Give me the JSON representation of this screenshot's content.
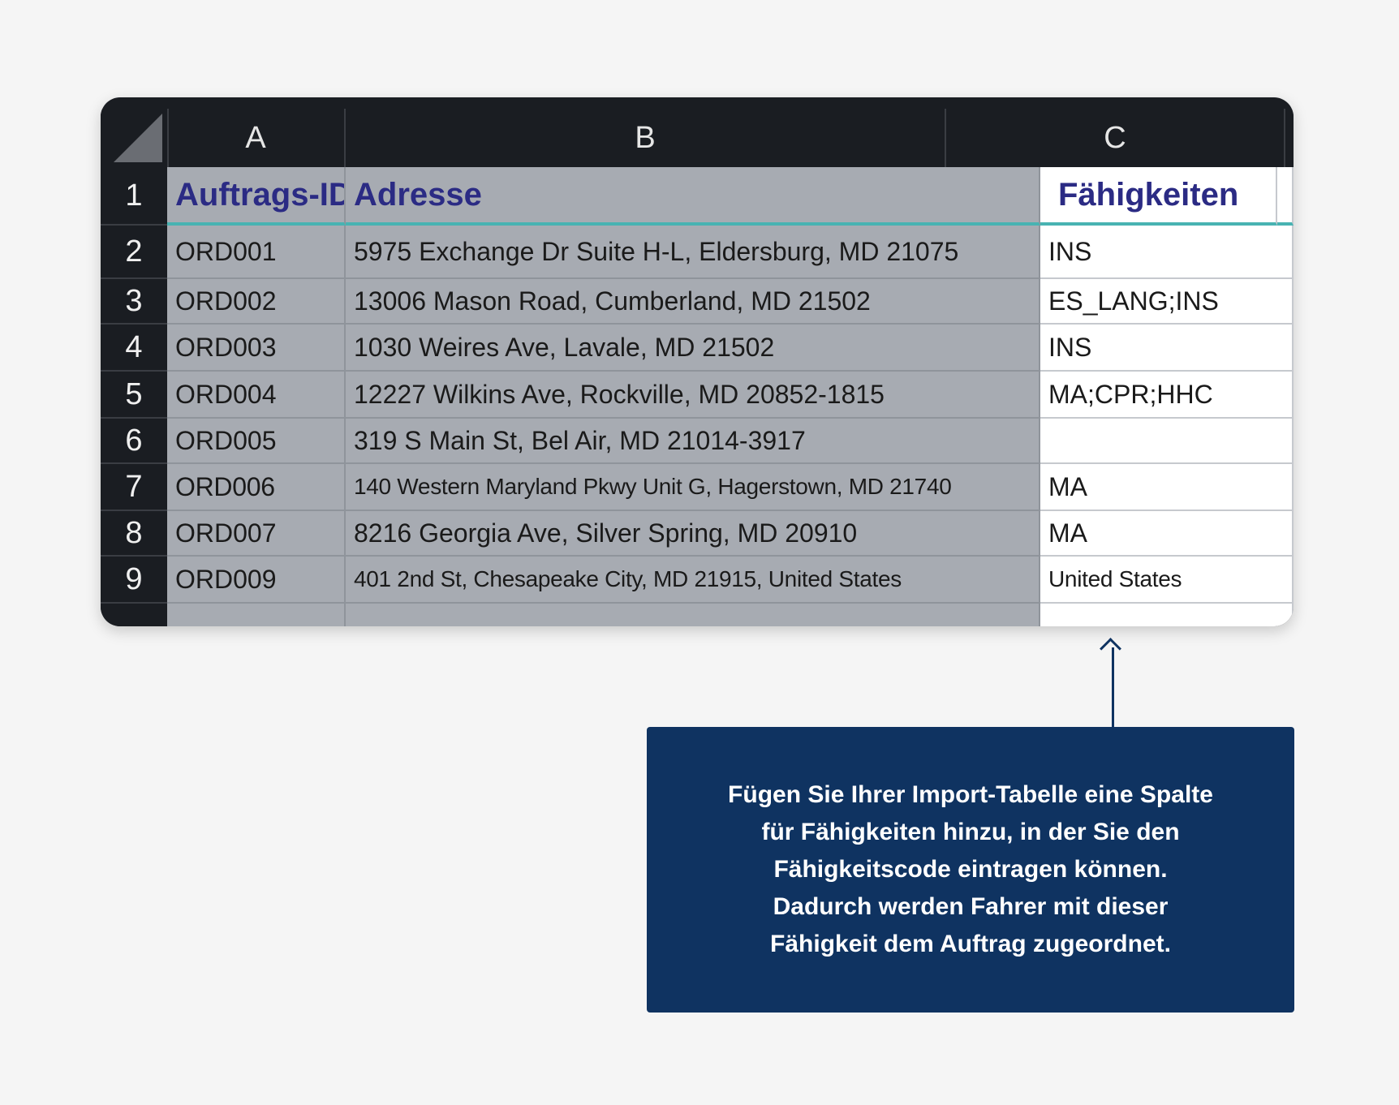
{
  "columns": [
    "A",
    "B",
    "C"
  ],
  "row_numbers": [
    "1",
    "2",
    "3",
    "4",
    "5",
    "6",
    "7",
    "8",
    "9"
  ],
  "header_row": {
    "a": "Auftrags-ID",
    "b": "Adresse",
    "c": "Fähigkeiten"
  },
  "rows": [
    {
      "a": "ORD001",
      "b": "5975 Exchange Dr Suite H-L, Eldersburg, MD 21075",
      "c": "INS"
    },
    {
      "a": "ORD002",
      "b": "13006 Mason Road, Cumberland, MD 21502",
      "c": "ES_LANG;INS"
    },
    {
      "a": "ORD003",
      "b": "1030 Weires Ave, Lavale, MD 21502",
      "c": "INS"
    },
    {
      "a": "ORD004",
      "b": "12227 Wilkins Ave, Rockville, MD 20852-1815",
      "c": "MA;CPR;HHC"
    },
    {
      "a": "ORD005",
      "b": "319 S Main St, Bel Air, MD 21014-3917",
      "c": ""
    },
    {
      "a": "ORD006",
      "b": "140 Western Maryland Pkwy Unit G, Hagerstown, MD 21740",
      "c": "MA"
    },
    {
      "a": "ORD007",
      "b": "8216 Georgia Ave, Silver Spring, MD 20910",
      "c": "MA"
    },
    {
      "a": "ORD009",
      "b": "401 2nd St, Chesapeake City, MD 21915, United States",
      "c": "United States"
    }
  ],
  "callout": {
    "lines": [
      "Fügen Sie Ihrer Import-Tabelle eine Spalte",
      "für Fähigkeiten hinzu, in der Sie den",
      "Fähigkeitscode eintragen können.",
      "Dadurch werden Fahrer mit dieser",
      "Fähigkeit dem Auftrag zugeordnet."
    ]
  }
}
